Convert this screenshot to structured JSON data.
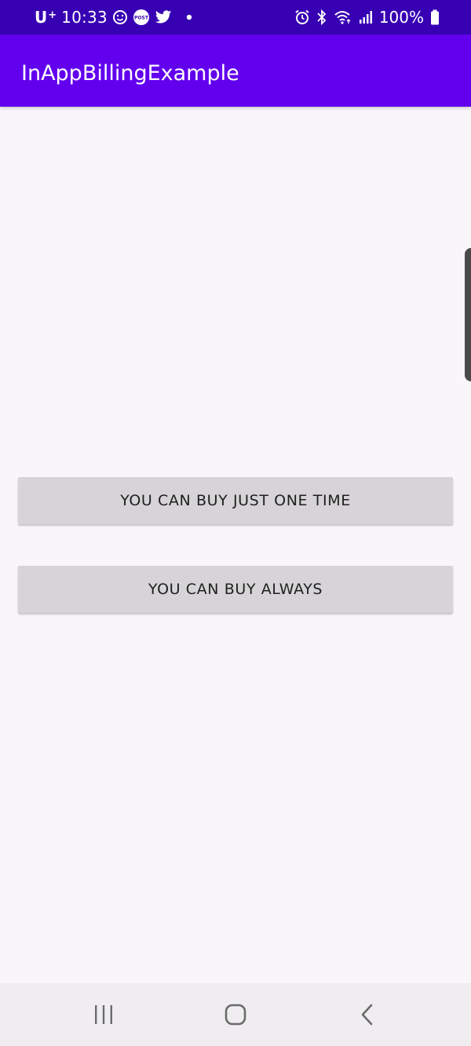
{
  "status_bar": {
    "carrier": "U",
    "carrier_sup": "+",
    "time": "10:33",
    "left_icons": [
      "smiley-icon",
      "post-icon",
      "twitter-icon",
      "dot-icon"
    ],
    "post_label": "POST",
    "battery": "100%",
    "right_icons": [
      "alarm-icon",
      "bluetooth-icon",
      "wifi-icon",
      "signal-icon",
      "battery-icon"
    ]
  },
  "app_bar": {
    "title": "InAppBillingExample"
  },
  "buttons": [
    {
      "label": "YOU CAN BUY JUST ONE TIME"
    },
    {
      "label": "YOU CAN BUY ALWAYS"
    }
  ],
  "nav_bar": {
    "items": [
      "recents-icon",
      "home-icon",
      "back-icon"
    ]
  },
  "colors": {
    "status_bar": "#3700b3",
    "app_bar": "#6200ee",
    "background": "#f8f6f9",
    "button": "#d6d4d7",
    "nav_bar": "#efedf0"
  }
}
